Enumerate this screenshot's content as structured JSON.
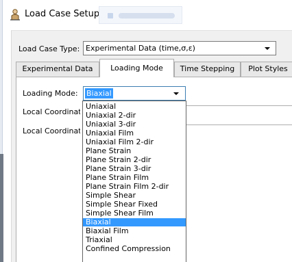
{
  "window": {
    "title": "Load Case Setup",
    "icon": "load-case-setup-icon"
  },
  "load_case_type": {
    "label": "Load Case Type:",
    "value": "Experimental Data (time,σ,ε)"
  },
  "tabs": [
    {
      "label": "Experimental Data",
      "active": false
    },
    {
      "label": "Loading Mode",
      "active": true
    },
    {
      "label": "Time Stepping",
      "active": false
    },
    {
      "label": "Plot Styles",
      "active": false
    }
  ],
  "loading_mode": {
    "label": "Loading Mode:",
    "value": "Biaxial",
    "options": [
      "Uniaxial",
      "Uniaxial 2-dir",
      "Uniaxial 3-dir",
      "Uniaxial Film",
      "Uniaxial Film 2-dir",
      "Plane Strain",
      "Plane Strain 2-dir",
      "Plane Strain 3-dir",
      "Plane Strain Film",
      "Plane Strain Film 2-dir",
      "Simple Shear",
      "Simple Shear Fixed",
      "Simple Shear Film",
      "Biaxial",
      "Biaxial Film",
      "Triaxial",
      "Confined Compression"
    ],
    "selected_index": 13
  },
  "local_coordinate_1": {
    "label": "Local Coordinate"
  },
  "local_coordinate_2": {
    "label": "Local Coordinate"
  },
  "colors": {
    "selection": "#3399ff",
    "dialog_bg": "#f0f0f0"
  }
}
